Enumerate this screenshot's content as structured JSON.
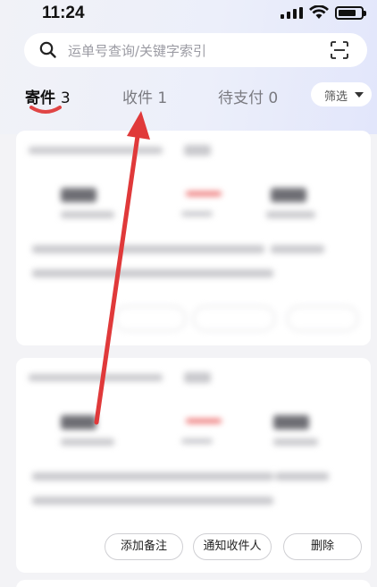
{
  "status_bar": {
    "time": "11:24"
  },
  "search": {
    "placeholder": "运单号查询/关键字索引"
  },
  "tabs": [
    {
      "label": "寄件",
      "count": "3"
    },
    {
      "label": "收件",
      "count": "1"
    },
    {
      "label": "待支付",
      "count": "0"
    }
  ],
  "filter": {
    "label": "筛选"
  },
  "card2_actions": {
    "note": "添加备注",
    "notify": "通知收件人",
    "delete": "删除"
  },
  "colors": {
    "accent_red": "#e0393a",
    "underline_red": "#e04545",
    "card_bg": "#ffffff",
    "page_bg": "#f3f3f6"
  },
  "icons": [
    "search-icon",
    "scan-icon",
    "caret-down-icon",
    "signal-icon",
    "wifi-icon",
    "battery-icon",
    "red-arrow-annotation"
  ]
}
